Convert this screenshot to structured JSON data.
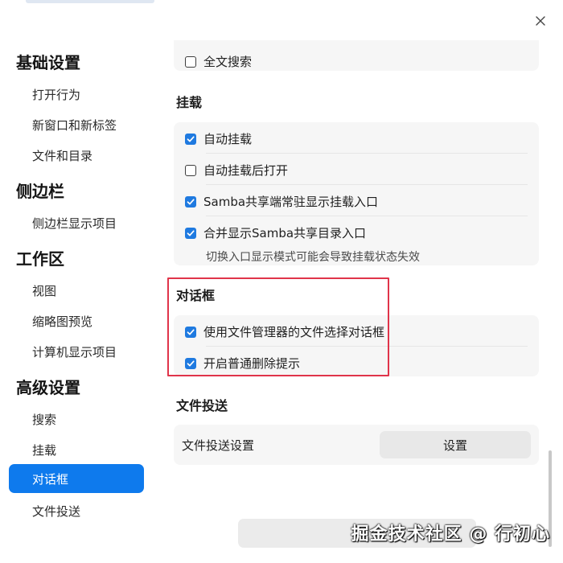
{
  "close_icon": "close-icon",
  "sidebar": {
    "groups": [
      {
        "label": "基础设置",
        "items": [
          "打开行为",
          "新窗口和新标签",
          "文件和目录"
        ]
      },
      {
        "label": "侧边栏",
        "items": [
          "侧边栏显示项目"
        ]
      },
      {
        "label": "工作区",
        "items": [
          "视图",
          "缩略图预览",
          "计算机显示项目"
        ]
      },
      {
        "label": "高级设置",
        "items": [
          "搜索",
          "挂载",
          "对话框",
          "文件投送"
        ]
      }
    ],
    "active_item": "对话框"
  },
  "content": {
    "partial_row": {
      "label": "全文搜索",
      "checked": false
    },
    "mount": {
      "title": "挂载",
      "options": [
        {
          "label": "自动挂载",
          "checked": true
        },
        {
          "label": "自动挂载后打开",
          "checked": false
        },
        {
          "label": "Samba共享端常驻显示挂载入口",
          "checked": true
        },
        {
          "label": "合并显示Samba共享目录入口",
          "checked": true
        }
      ],
      "hint": "切换入口显示模式可能会导致挂载状态失效"
    },
    "dialog": {
      "title": "对话框",
      "options": [
        {
          "label": "使用文件管理器的文件选择对话框",
          "checked": true
        },
        {
          "label": "开启普通删除提示",
          "checked": true
        }
      ]
    },
    "file_transfer": {
      "title": "文件投送",
      "row_label": "文件投送设置",
      "button_label": "设置"
    }
  },
  "colors": {
    "accent": "#0e7aed",
    "checkbox": "#1f7ae0",
    "highlight": "#e0344a"
  },
  "watermark": "掘金技术社区 @ 行初心"
}
